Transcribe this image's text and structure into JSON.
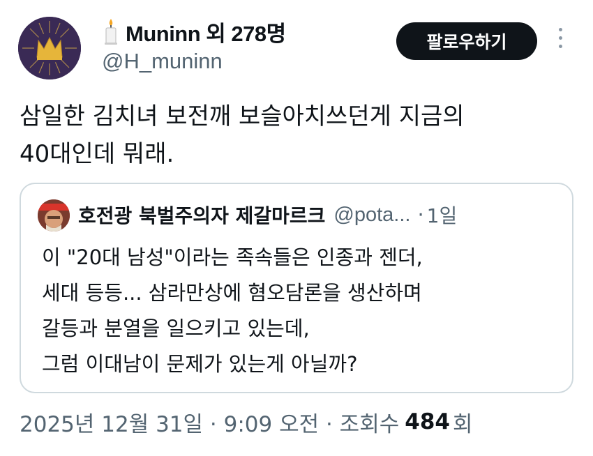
{
  "author": {
    "display_name": "Muninn 외 278명",
    "handle": "@H_muninn",
    "avatar_icon": "crown-avatar",
    "name_prefix_icon": "candle-icon"
  },
  "follow_button": {
    "label": "팔로우하기"
  },
  "more_icon": "vertical-ellipsis-icon",
  "tweet": {
    "text": "삼일한 김치녀 보전깨 보슬아치쓰던게 지금의\n40대인데 뭐래."
  },
  "quote": {
    "avatar_icon": "user-avatar",
    "display_name": "호전광 북벌주의자 제갈마르크",
    "handle": "@pota...",
    "separator": "·",
    "time": "1일",
    "text": "이 \"20대 남성\"이라는 족속들은 인종과 젠더,\n세대 등등... 삼라만상에 혐오담론을 생산하며\n갈등과 분열을 일으키고 있는데,\n그럼 이대남이 문제가 있는게 아닐까?"
  },
  "meta": {
    "timestamp": "2025년 12월 31일 · 9:09 오전 · 조회수",
    "views": "484",
    "views_suffix": "회"
  },
  "colors": {
    "text_primary": "#0f1419",
    "text_secondary": "#536471",
    "border": "#cfd9de",
    "button_bg": "#0f1419",
    "avatar_bg": "#3a2a55",
    "crown": "#e6b53a"
  }
}
